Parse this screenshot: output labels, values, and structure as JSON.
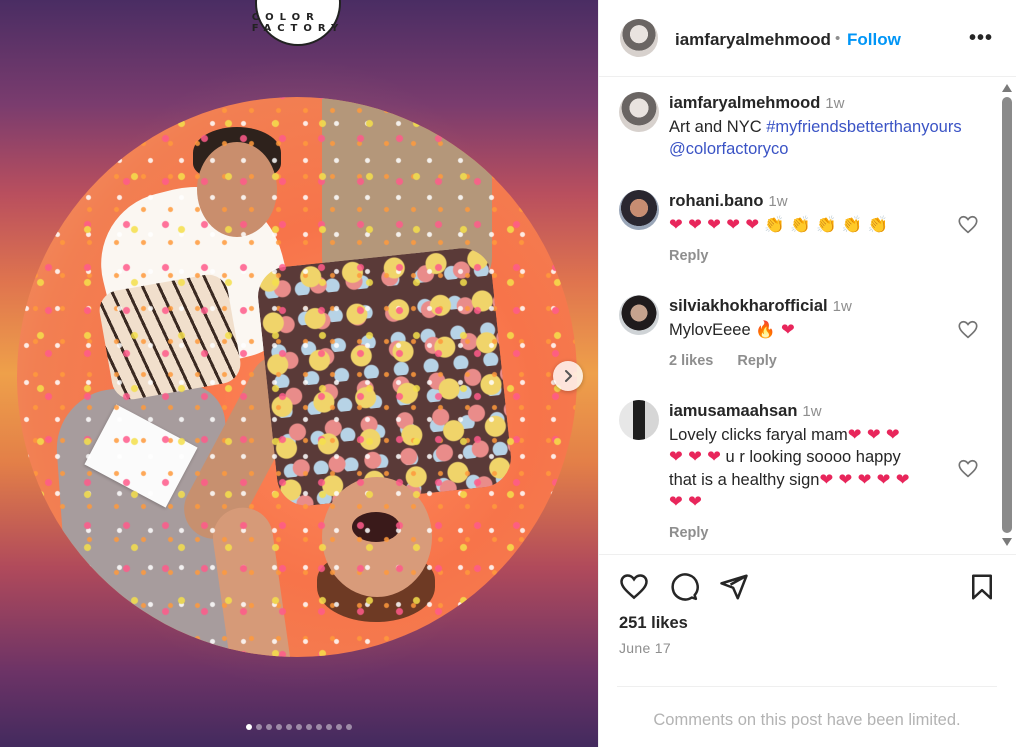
{
  "post": {
    "media": {
      "logo_text": "COLOR FACTORY",
      "slide_count": 11,
      "active_index": 0
    },
    "header": {
      "username": "iamfaryalmehmood",
      "separator": "•",
      "follow_label": "Follow",
      "more_label": "•••"
    },
    "caption": {
      "username": "iamfaryalmehmood",
      "time": "1w",
      "text": "Art and NYC ",
      "hashtag": "#myfriendsbetterthanyours",
      "mention": "@colorfactoryco"
    },
    "comments": [
      {
        "username": "rohani.bano",
        "time": "1w",
        "emojis": "❤❤❤❤❤👏👏👏👏👏",
        "reply_label": "Reply"
      },
      {
        "username": "silviakhokharofficial",
        "time": "1w",
        "text": "MylovEeee",
        "emojis": "🔥 ❤",
        "likes_label": "2 likes",
        "reply_label": "Reply"
      },
      {
        "username": "iamusamaahsan",
        "time": "1w",
        "text_1": "Lovely clicks faryal mam",
        "emojis_1": "❤ ❤ ❤",
        "emojis_2": "❤ ❤ ❤",
        "text_2": " u r looking soooo happy",
        "text_3": "that is a healthy sign",
        "emojis_3": "❤ ❤ ❤ ❤ ❤",
        "emojis_4": "❤ ❤",
        "reply_label": "Reply"
      }
    ],
    "likes": "251 likes",
    "date": "June 17",
    "limited_notice": "Comments on this post have been limited."
  },
  "colors": {
    "follow": "#0095f6",
    "heart_emoji": "#e8265b",
    "link": "#3a53c5",
    "muted": "#8e8e8e"
  }
}
